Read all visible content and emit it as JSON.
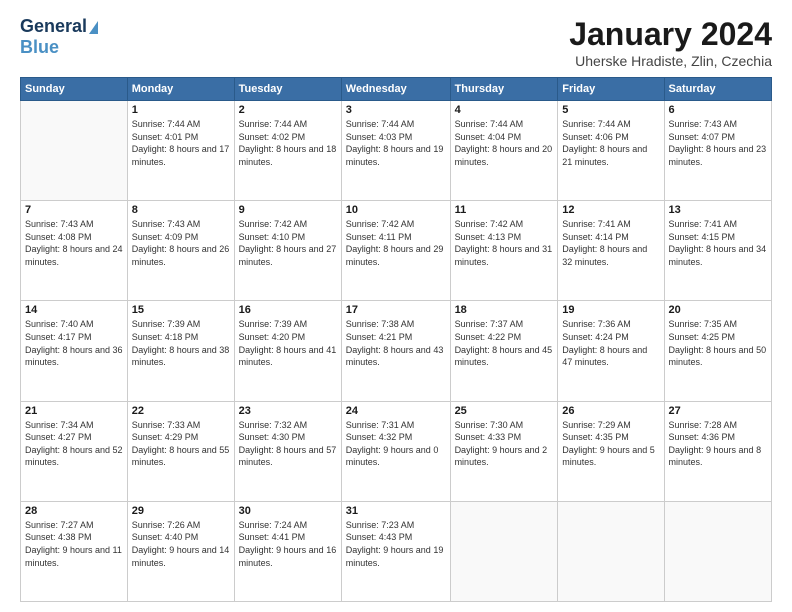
{
  "logo": {
    "line1": "General",
    "line2": "Blue"
  },
  "title": "January 2024",
  "subtitle": "Uherske Hradiste, Zlin, Czechia",
  "days_of_week": [
    "Sunday",
    "Monday",
    "Tuesday",
    "Wednesday",
    "Thursday",
    "Friday",
    "Saturday"
  ],
  "weeks": [
    [
      {
        "day": "",
        "sunrise": "",
        "sunset": "",
        "daylight": ""
      },
      {
        "day": "1",
        "sunrise": "Sunrise: 7:44 AM",
        "sunset": "Sunset: 4:01 PM",
        "daylight": "Daylight: 8 hours and 17 minutes."
      },
      {
        "day": "2",
        "sunrise": "Sunrise: 7:44 AM",
        "sunset": "Sunset: 4:02 PM",
        "daylight": "Daylight: 8 hours and 18 minutes."
      },
      {
        "day": "3",
        "sunrise": "Sunrise: 7:44 AM",
        "sunset": "Sunset: 4:03 PM",
        "daylight": "Daylight: 8 hours and 19 minutes."
      },
      {
        "day": "4",
        "sunrise": "Sunrise: 7:44 AM",
        "sunset": "Sunset: 4:04 PM",
        "daylight": "Daylight: 8 hours and 20 minutes."
      },
      {
        "day": "5",
        "sunrise": "Sunrise: 7:44 AM",
        "sunset": "Sunset: 4:06 PM",
        "daylight": "Daylight: 8 hours and 21 minutes."
      },
      {
        "day": "6",
        "sunrise": "Sunrise: 7:43 AM",
        "sunset": "Sunset: 4:07 PM",
        "daylight": "Daylight: 8 hours and 23 minutes."
      }
    ],
    [
      {
        "day": "7",
        "sunrise": "Sunrise: 7:43 AM",
        "sunset": "Sunset: 4:08 PM",
        "daylight": "Daylight: 8 hours and 24 minutes."
      },
      {
        "day": "8",
        "sunrise": "Sunrise: 7:43 AM",
        "sunset": "Sunset: 4:09 PM",
        "daylight": "Daylight: 8 hours and 26 minutes."
      },
      {
        "day": "9",
        "sunrise": "Sunrise: 7:42 AM",
        "sunset": "Sunset: 4:10 PM",
        "daylight": "Daylight: 8 hours and 27 minutes."
      },
      {
        "day": "10",
        "sunrise": "Sunrise: 7:42 AM",
        "sunset": "Sunset: 4:11 PM",
        "daylight": "Daylight: 8 hours and 29 minutes."
      },
      {
        "day": "11",
        "sunrise": "Sunrise: 7:42 AM",
        "sunset": "Sunset: 4:13 PM",
        "daylight": "Daylight: 8 hours and 31 minutes."
      },
      {
        "day": "12",
        "sunrise": "Sunrise: 7:41 AM",
        "sunset": "Sunset: 4:14 PM",
        "daylight": "Daylight: 8 hours and 32 minutes."
      },
      {
        "day": "13",
        "sunrise": "Sunrise: 7:41 AM",
        "sunset": "Sunset: 4:15 PM",
        "daylight": "Daylight: 8 hours and 34 minutes."
      }
    ],
    [
      {
        "day": "14",
        "sunrise": "Sunrise: 7:40 AM",
        "sunset": "Sunset: 4:17 PM",
        "daylight": "Daylight: 8 hours and 36 minutes."
      },
      {
        "day": "15",
        "sunrise": "Sunrise: 7:39 AM",
        "sunset": "Sunset: 4:18 PM",
        "daylight": "Daylight: 8 hours and 38 minutes."
      },
      {
        "day": "16",
        "sunrise": "Sunrise: 7:39 AM",
        "sunset": "Sunset: 4:20 PM",
        "daylight": "Daylight: 8 hours and 41 minutes."
      },
      {
        "day": "17",
        "sunrise": "Sunrise: 7:38 AM",
        "sunset": "Sunset: 4:21 PM",
        "daylight": "Daylight: 8 hours and 43 minutes."
      },
      {
        "day": "18",
        "sunrise": "Sunrise: 7:37 AM",
        "sunset": "Sunset: 4:22 PM",
        "daylight": "Daylight: 8 hours and 45 minutes."
      },
      {
        "day": "19",
        "sunrise": "Sunrise: 7:36 AM",
        "sunset": "Sunset: 4:24 PM",
        "daylight": "Daylight: 8 hours and 47 minutes."
      },
      {
        "day": "20",
        "sunrise": "Sunrise: 7:35 AM",
        "sunset": "Sunset: 4:25 PM",
        "daylight": "Daylight: 8 hours and 50 minutes."
      }
    ],
    [
      {
        "day": "21",
        "sunrise": "Sunrise: 7:34 AM",
        "sunset": "Sunset: 4:27 PM",
        "daylight": "Daylight: 8 hours and 52 minutes."
      },
      {
        "day": "22",
        "sunrise": "Sunrise: 7:33 AM",
        "sunset": "Sunset: 4:29 PM",
        "daylight": "Daylight: 8 hours and 55 minutes."
      },
      {
        "day": "23",
        "sunrise": "Sunrise: 7:32 AM",
        "sunset": "Sunset: 4:30 PM",
        "daylight": "Daylight: 8 hours and 57 minutes."
      },
      {
        "day": "24",
        "sunrise": "Sunrise: 7:31 AM",
        "sunset": "Sunset: 4:32 PM",
        "daylight": "Daylight: 9 hours and 0 minutes."
      },
      {
        "day": "25",
        "sunrise": "Sunrise: 7:30 AM",
        "sunset": "Sunset: 4:33 PM",
        "daylight": "Daylight: 9 hours and 2 minutes."
      },
      {
        "day": "26",
        "sunrise": "Sunrise: 7:29 AM",
        "sunset": "Sunset: 4:35 PM",
        "daylight": "Daylight: 9 hours and 5 minutes."
      },
      {
        "day": "27",
        "sunrise": "Sunrise: 7:28 AM",
        "sunset": "Sunset: 4:36 PM",
        "daylight": "Daylight: 9 hours and 8 minutes."
      }
    ],
    [
      {
        "day": "28",
        "sunrise": "Sunrise: 7:27 AM",
        "sunset": "Sunset: 4:38 PM",
        "daylight": "Daylight: 9 hours and 11 minutes."
      },
      {
        "day": "29",
        "sunrise": "Sunrise: 7:26 AM",
        "sunset": "Sunset: 4:40 PM",
        "daylight": "Daylight: 9 hours and 14 minutes."
      },
      {
        "day": "30",
        "sunrise": "Sunrise: 7:24 AM",
        "sunset": "Sunset: 4:41 PM",
        "daylight": "Daylight: 9 hours and 16 minutes."
      },
      {
        "day": "31",
        "sunrise": "Sunrise: 7:23 AM",
        "sunset": "Sunset: 4:43 PM",
        "daylight": "Daylight: 9 hours and 19 minutes."
      },
      {
        "day": "",
        "sunrise": "",
        "sunset": "",
        "daylight": ""
      },
      {
        "day": "",
        "sunrise": "",
        "sunset": "",
        "daylight": ""
      },
      {
        "day": "",
        "sunrise": "",
        "sunset": "",
        "daylight": ""
      }
    ]
  ]
}
